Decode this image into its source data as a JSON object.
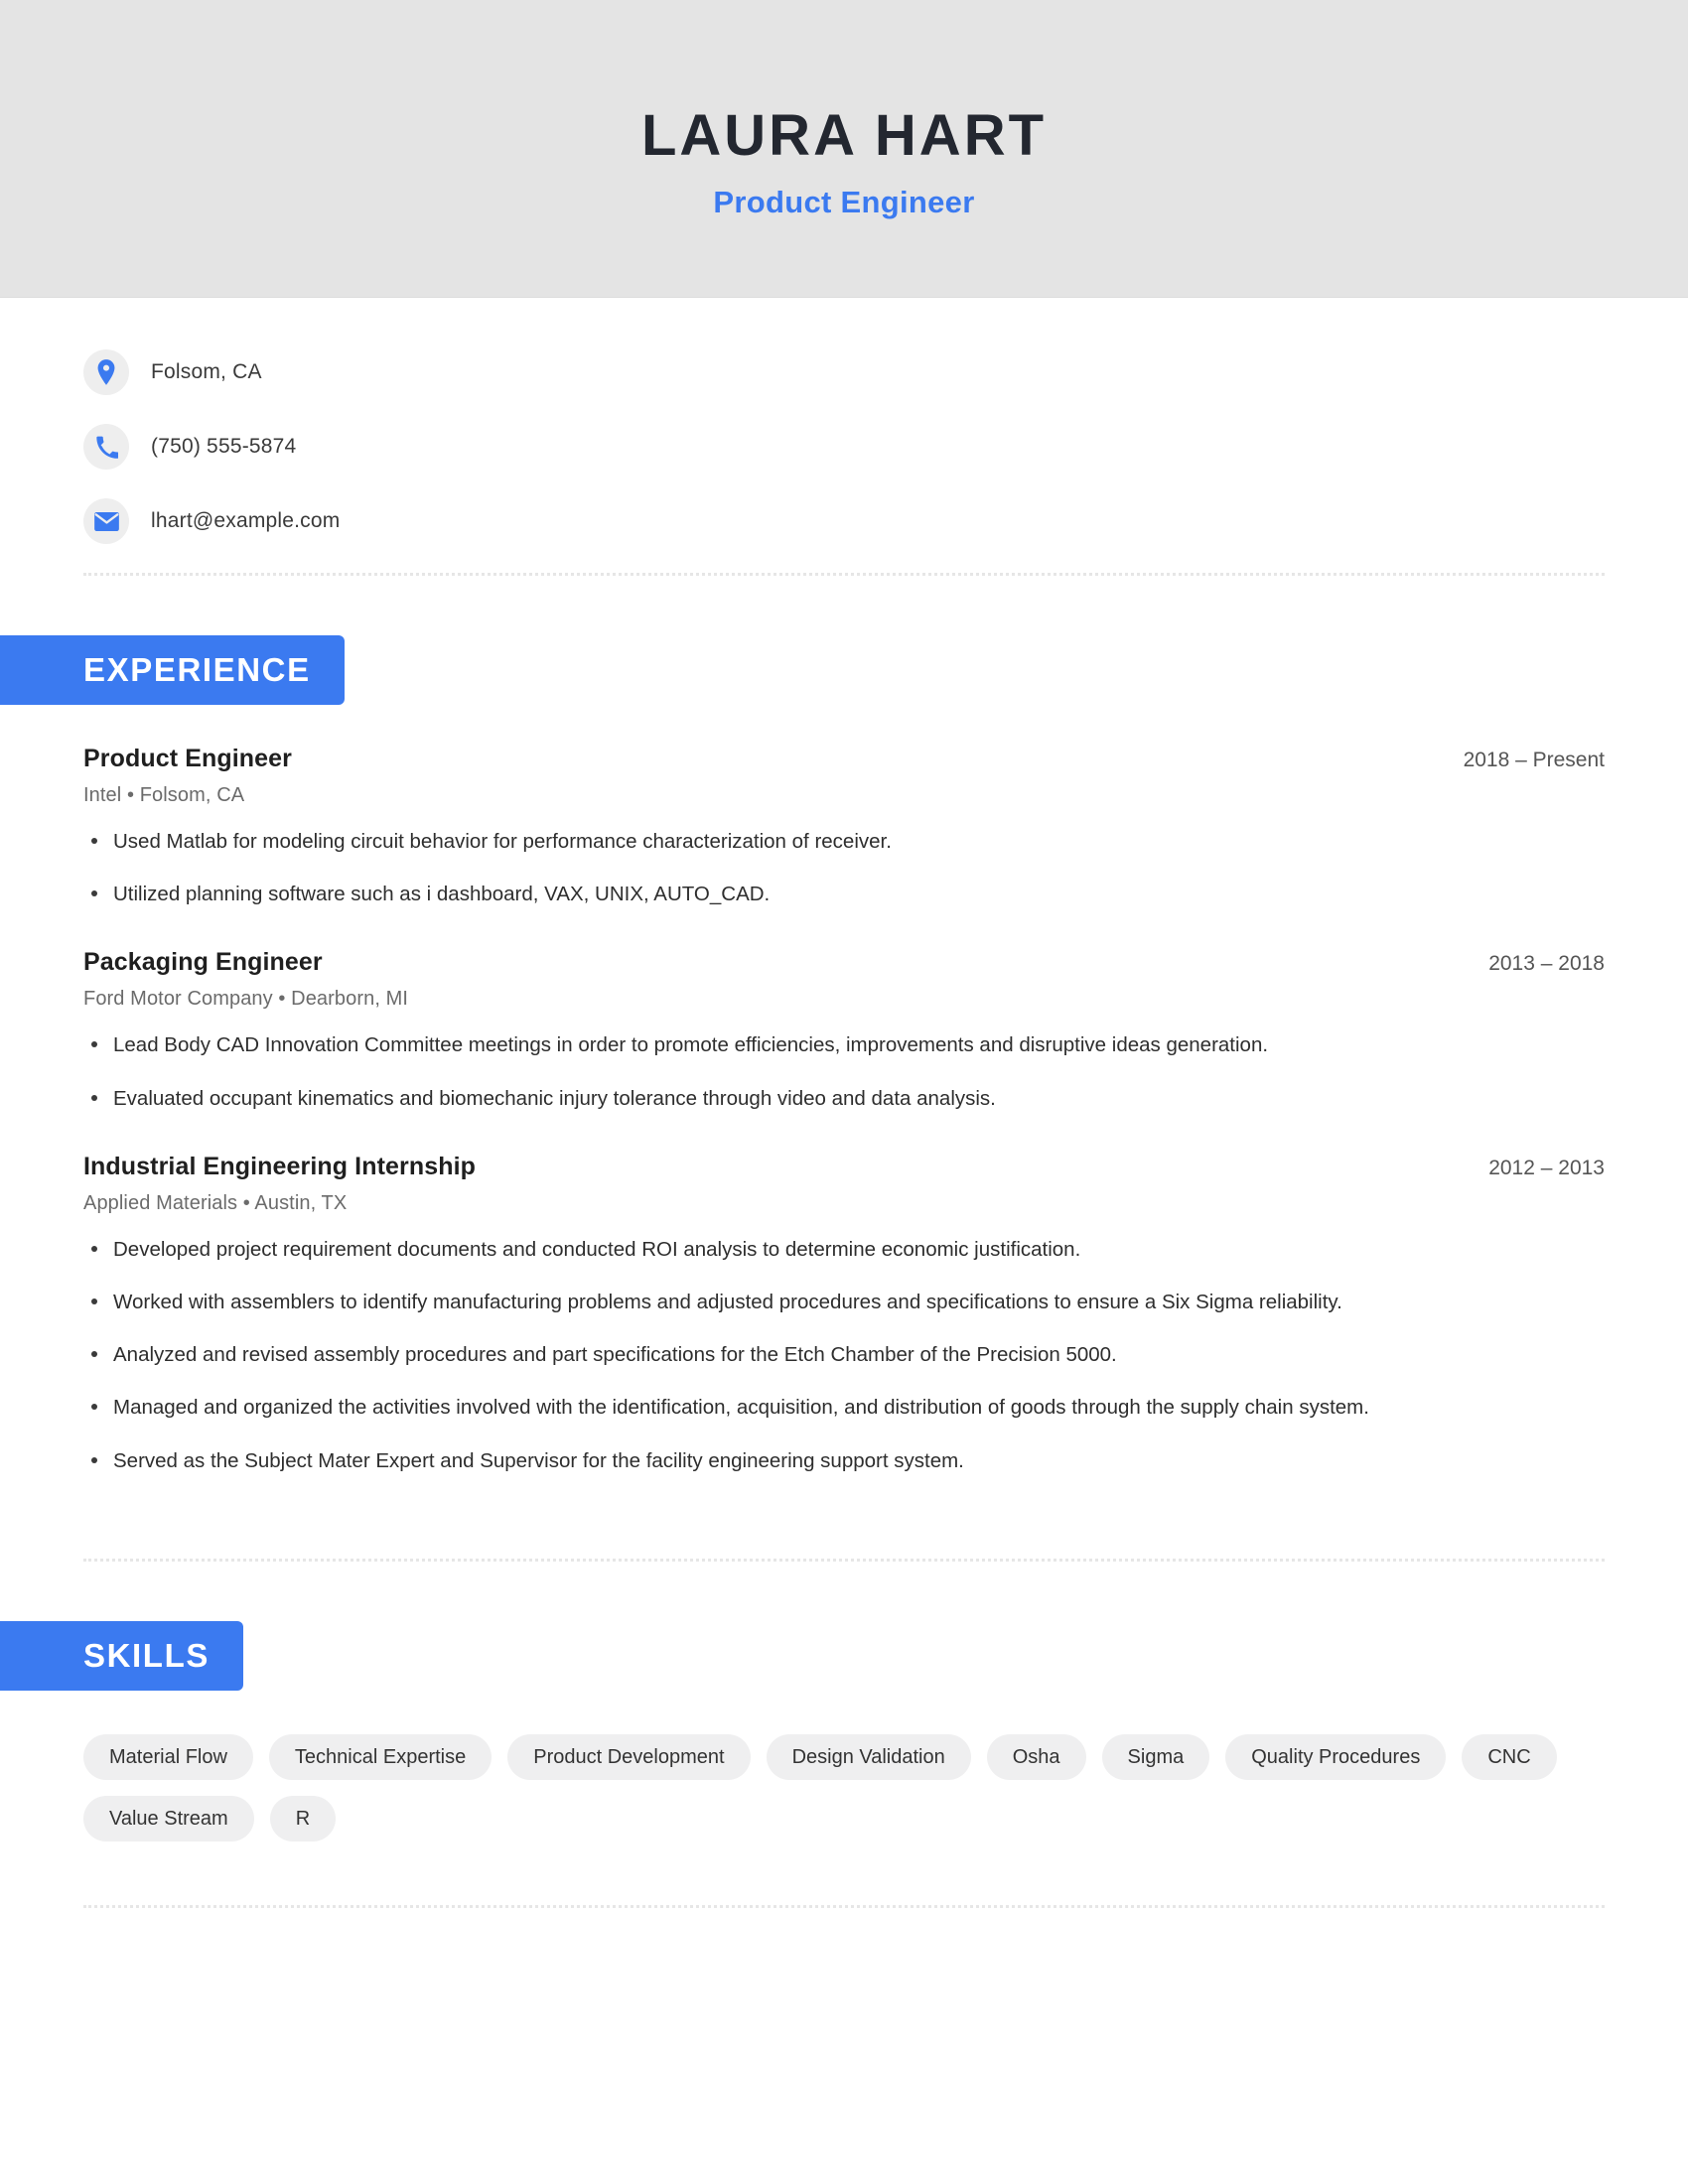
{
  "header": {
    "name": "LAURA HART",
    "job_title": "Product Engineer",
    "background_color": "#e4e4e4",
    "accent_color": "#3b7af0"
  },
  "contact": {
    "items": [
      {
        "icon": "location-pin-icon",
        "value": "Folsom, CA"
      },
      {
        "icon": "phone-icon",
        "value": "(750) 555-5874"
      },
      {
        "icon": "email-icon",
        "value": "lhart@example.com"
      }
    ]
  },
  "experience": {
    "heading": "EXPERIENCE",
    "entries": [
      {
        "role": "Product Engineer",
        "company_location": "Intel  •  Folsom, CA",
        "dates": "2018 – Present",
        "bullets": [
          "Used Matlab for modeling circuit behavior for performance characterization of receiver.",
          "Utilized planning software such as i dashboard, VAX, UNIX, AUTO_CAD."
        ]
      },
      {
        "role": "Packaging Engineer",
        "company_location": "Ford Motor Company  •  Dearborn, MI",
        "dates": "2013 – 2018",
        "bullets": [
          "Lead Body CAD Innovation Committee meetings in order to promote efficiencies, improvements and disruptive ideas generation.",
          "Evaluated occupant kinematics and biomechanic injury tolerance through video and data analysis."
        ]
      },
      {
        "role": "Industrial Engineering Internship",
        "company_location": "Applied Materials  •  Austin, TX",
        "dates": "2012 – 2013",
        "bullets": [
          "Developed project requirement documents and conducted ROI analysis to determine economic justification.",
          "Worked with assemblers to identify manufacturing problems and adjusted procedures and specifications to ensure a Six Sigma reliability.",
          "Analyzed and revised assembly procedures and part specifications for the Etch Chamber of the Precision 5000.",
          "Managed and organized the activities involved with the identification, acquisition, and distribution of goods through the supply chain system.",
          "Served as the Subject Mater Expert and Supervisor for the facility engineering support system."
        ]
      }
    ]
  },
  "skills": {
    "heading": "SKILLS",
    "items": [
      "Material Flow",
      "Technical Expertise",
      "Product Development",
      "Design Validation",
      "Osha",
      "Sigma",
      "Quality Procedures",
      "CNC",
      "Value Stream",
      "R"
    ]
  }
}
